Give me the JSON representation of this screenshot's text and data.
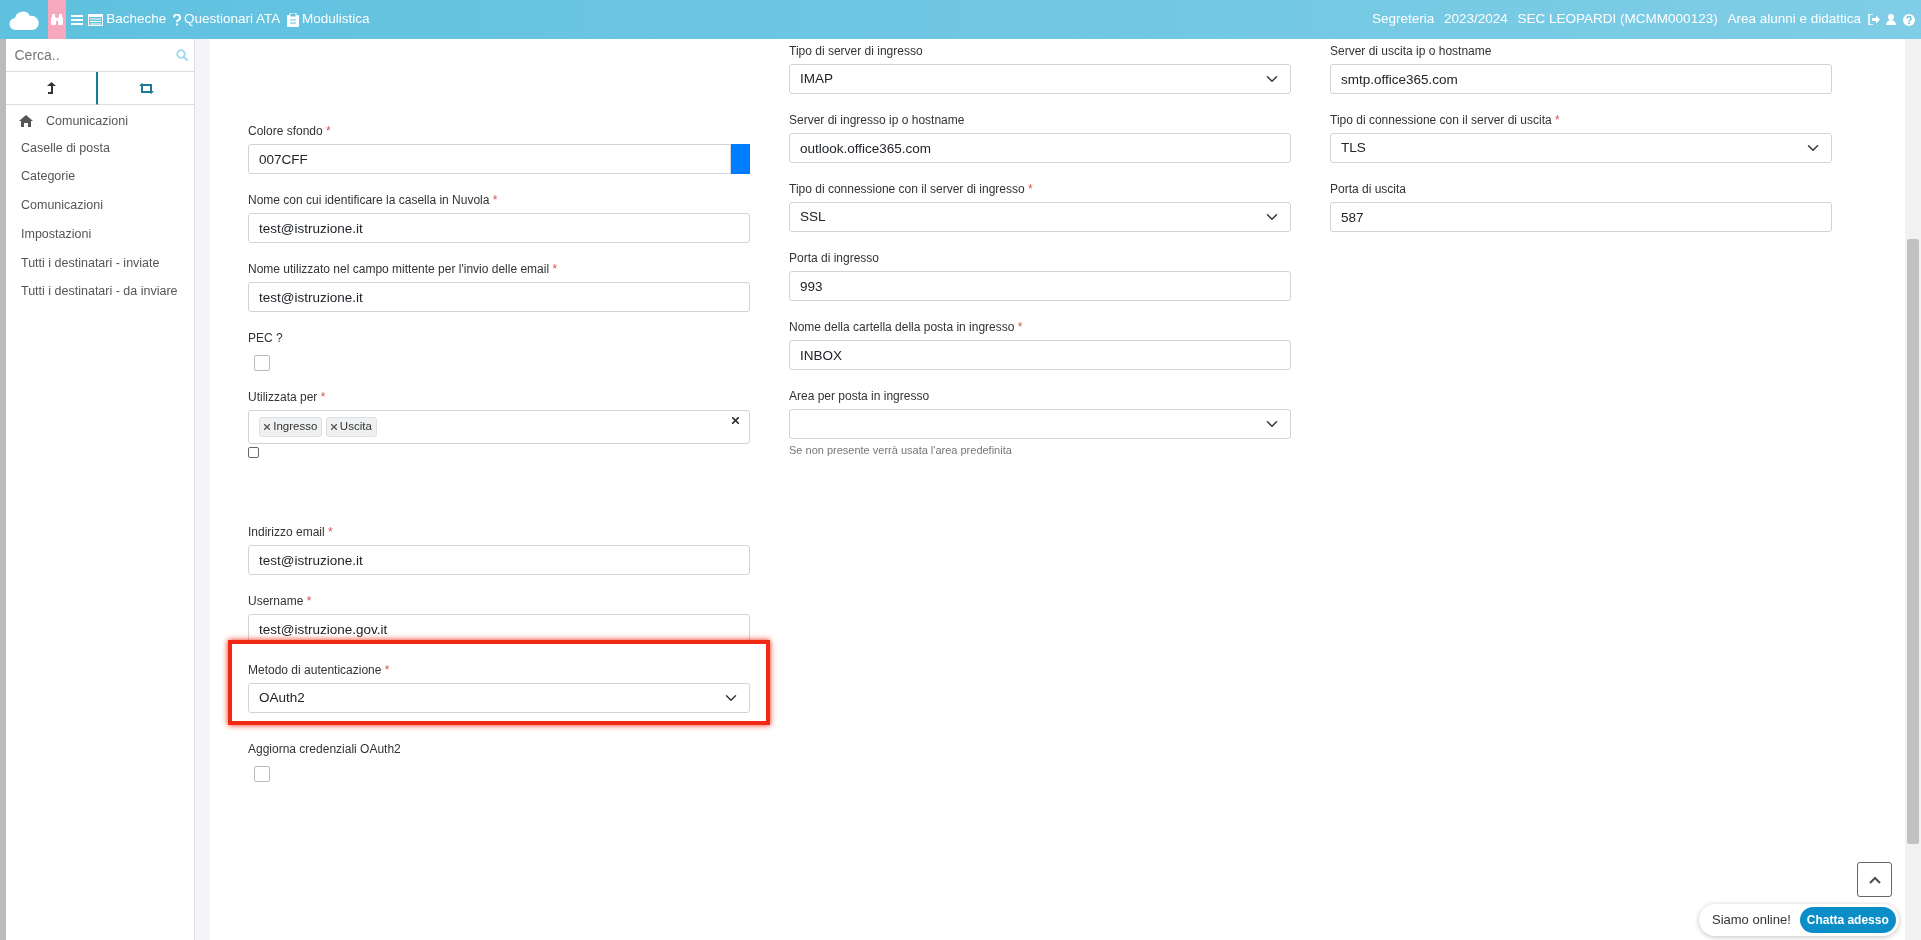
{
  "topbar": {
    "nav": [
      {
        "label": "Bacheche",
        "kind": "table"
      },
      {
        "label": "Questionari ATA",
        "kind": "question"
      },
      {
        "label": "Modulistica",
        "kind": "clipboard"
      }
    ],
    "info": [
      "Segreteria",
      "2023/2024",
      "SEC LEOPARDI (MCMM000123)",
      "Area alunni e didattica"
    ]
  },
  "sidebar": {
    "search": {
      "placeholder": "Cerca.."
    },
    "section": "Comunicazioni",
    "items": [
      {
        "label": "Caselle di posta"
      },
      {
        "label": "Categorie"
      },
      {
        "label": "Comunicazioni"
      },
      {
        "label": "Impostazioni"
      },
      {
        "label": "Tutti i destinatari - inviate"
      },
      {
        "label": "Tutti i destinatari - da inviare"
      }
    ]
  },
  "form": {
    "columns": [
      {
        "fields": [
          {
            "kind": "color",
            "label": "Colore sfondo",
            "required_mark": "*",
            "value": "007CFF"
          },
          {
            "kind": "text",
            "label": "Nome con cui identificare la casella in Nuvola",
            "required_mark": "*",
            "value": "test@istruzione.it"
          },
          {
            "kind": "text",
            "label": "Nome utilizzato nel campo mittente per l'invio delle email",
            "required_mark": "*",
            "value": "test@istruzione.it"
          },
          {
            "kind": "checkbox",
            "label": "PEC ?",
            "checked": false
          },
          {
            "kind": "tags",
            "label": "Utilizzata per",
            "required_mark": "*",
            "tags": [
              "Ingresso",
              "Uscita"
            ],
            "toggle_checked": false
          },
          {
            "kind": "text",
            "label": "Indirizzo email",
            "required_mark": "*",
            "value": "test@istruzione.it"
          },
          {
            "kind": "text",
            "label": "Username",
            "required_mark": "*",
            "value": "test@istruzione.gov.it"
          },
          {
            "kind": "select",
            "label": "Metodo di autenticazione",
            "required_mark": "*",
            "value": "OAuth2",
            "highlighted": true
          },
          {
            "kind": "checkbox",
            "label": "Aggiorna credenziali OAuth2",
            "checked": false
          }
        ]
      },
      {
        "fields": [
          {
            "kind": "select",
            "label": "Tipo di server di ingresso",
            "value": "IMAP"
          },
          {
            "kind": "text",
            "label": "Server di ingresso ip o hostname",
            "value": "outlook.office365.com"
          },
          {
            "kind": "select",
            "label": "Tipo di connessione con il server di ingresso",
            "required_mark": "*",
            "value": "SSL"
          },
          {
            "kind": "text",
            "label": "Porta di ingresso",
            "value": "993"
          },
          {
            "kind": "text",
            "label": "Nome della cartella della posta in ingresso",
            "required_mark": "*",
            "value": "INBOX"
          },
          {
            "kind": "select",
            "label": "Area per posta in ingresso",
            "help": "Se non presente verrà usata l'area predefinita"
          }
        ]
      },
      {
        "fields": [
          {
            "kind": "text",
            "label": "Server di uscita ip o hostname",
            "value": "smtp.office365.com"
          },
          {
            "kind": "select",
            "label": "Tipo di connessione con il server di uscita",
            "required_mark": "*",
            "value": "TLS"
          },
          {
            "kind": "text",
            "label": "Porta di uscita",
            "value": "587"
          }
        ]
      }
    ]
  },
  "chat": {
    "text": "Siamo online!",
    "button": "Chatta adesso"
  }
}
